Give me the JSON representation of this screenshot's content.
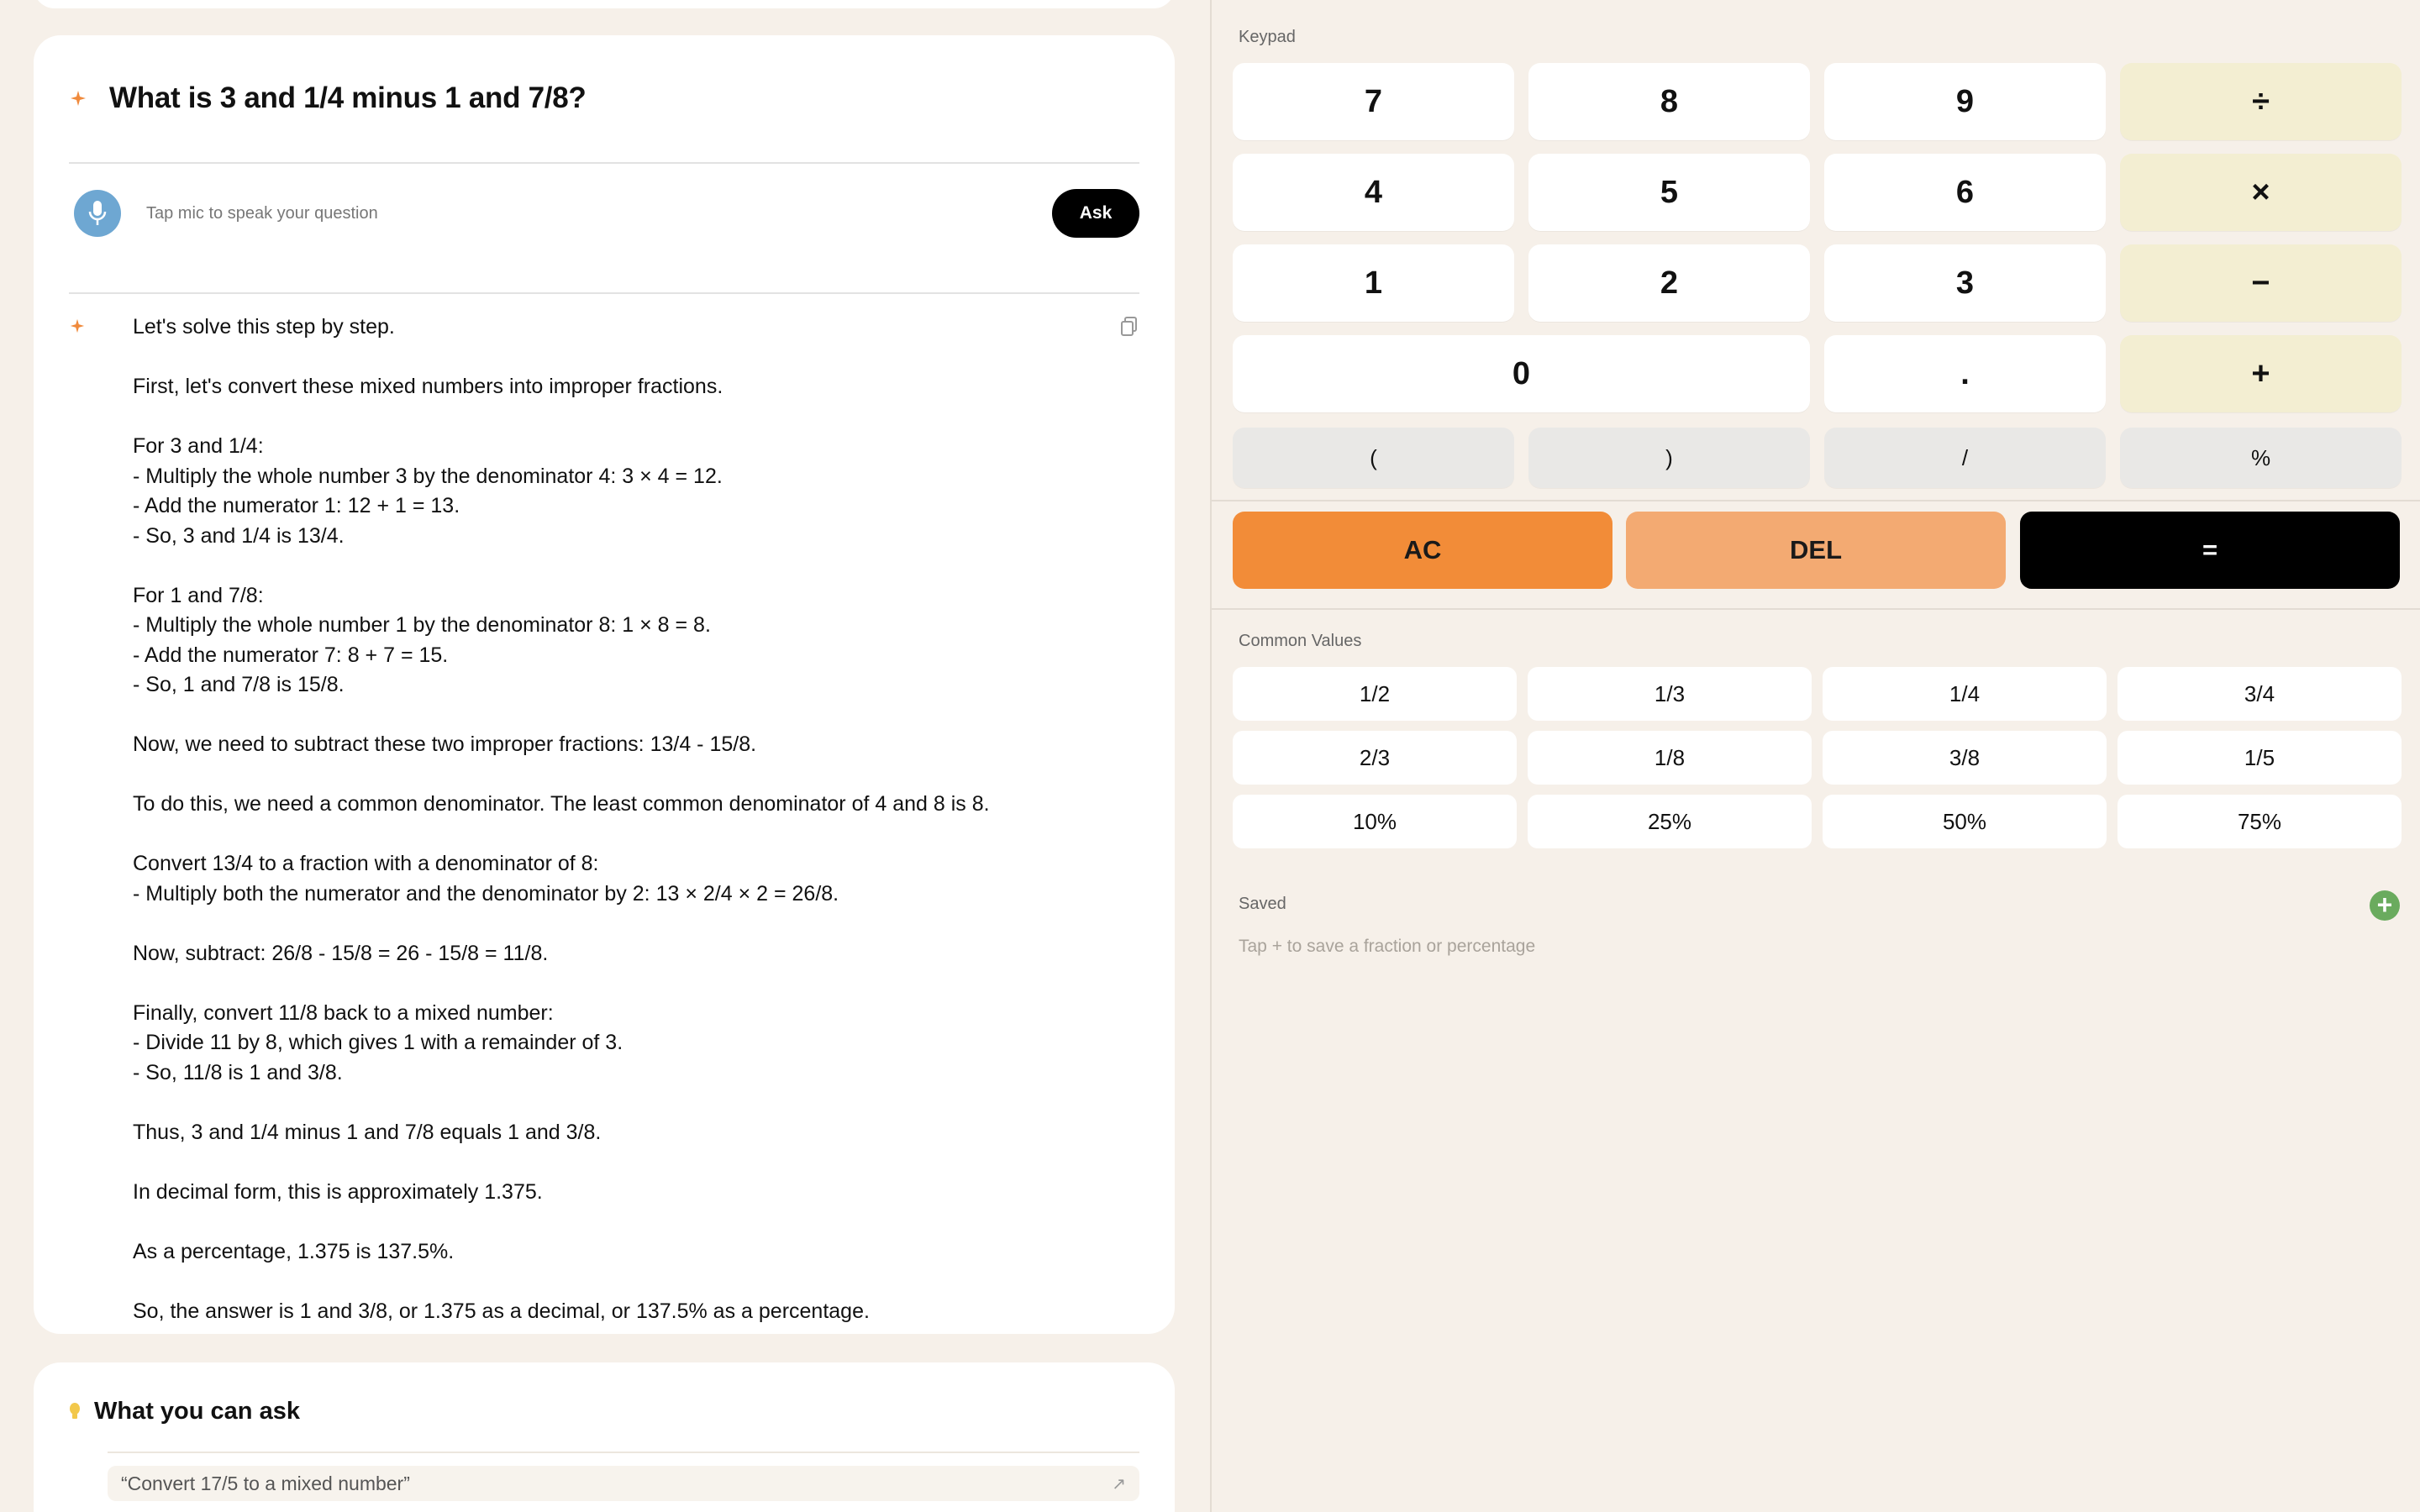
{
  "question": {
    "title": "What is 3 and 1/4 minus 1 and 7/8?",
    "ask_placeholder": "Tap mic to speak your question",
    "ask_label": "Ask"
  },
  "answer": {
    "lines": [
      "Let's solve this step by step.",
      "",
      "First, let's convert these mixed numbers into improper fractions.",
      "",
      "For 3 and 1/4:",
      "- Multiply the whole number 3 by the denominator 4: 3 × 4 = 12.",
      "- Add the numerator 1: 12 + 1 = 13.",
      "- So, 3 and 1/4 is 13/4.",
      "",
      "For 1 and 7/8:",
      "- Multiply the whole number 1 by the denominator 8: 1 × 8 = 8.",
      "- Add the numerator 7: 8 + 7 = 15.",
      "- So, 1 and 7/8 is 15/8.",
      "",
      "Now, we need to subtract these two improper fractions: 13/4 - 15/8.",
      "",
      "To do this, we need a common denominator. The least common denominator of 4 and 8 is 8.",
      "",
      "Convert 13/4 to a fraction with a denominator of 8:",
      "- Multiply both the numerator and the denominator by 2: 13 × 2/4 × 2 = 26/8.",
      "",
      "Now, subtract: 26/8 - 15/8 = 26 - 15/8 = 11/8.",
      "",
      "Finally, convert 11/8 back to a mixed number:",
      "- Divide 11 by 8, which gives 1 with a remainder of 3.",
      "- So, 11/8 is 1 and 3/8.",
      "",
      "Thus, 3 and 1/4 minus 1 and 7/8 equals 1 and 3/8.",
      "",
      "In decimal form, this is approximately 1.375.",
      "",
      "As a percentage, 1.375 is 137.5%.",
      "",
      "So, the answer is 1 and 3/8, or 1.375 as a decimal, or 137.5% as a percentage."
    ]
  },
  "ask_suggestions": {
    "title": "What you can ask",
    "items": [
      "“Convert 17/5 to a mixed number”"
    ]
  },
  "keypad": {
    "label": "Keypad",
    "row1": [
      "7",
      "8",
      "9",
      "÷"
    ],
    "row2": [
      "4",
      "5",
      "6",
      "×"
    ],
    "row3": [
      "1",
      "2",
      "3",
      "−"
    ],
    "row4": [
      "0",
      ".",
      "+"
    ],
    "row5": [
      "(",
      ")",
      "/",
      "%"
    ],
    "ac": "AC",
    "del": "DEL",
    "equals": "="
  },
  "common_values": {
    "label": "Common Values",
    "items": [
      "1/2",
      "1/3",
      "1/4",
      "3/4",
      "2/3",
      "1/8",
      "3/8",
      "1/5",
      "10%",
      "25%",
      "50%",
      "75%"
    ]
  },
  "saved": {
    "label": "Saved",
    "add_label": "+",
    "placeholder": "Tap + to save a fraction or percentage"
  },
  "colors": {
    "background": "#f6f0e9",
    "operator_key": "#f3eed2",
    "ac": "#f28c38",
    "del": "#f3aa72",
    "equals": "#000000",
    "mic": "#6ea7d2",
    "add": "#6aab5e"
  }
}
